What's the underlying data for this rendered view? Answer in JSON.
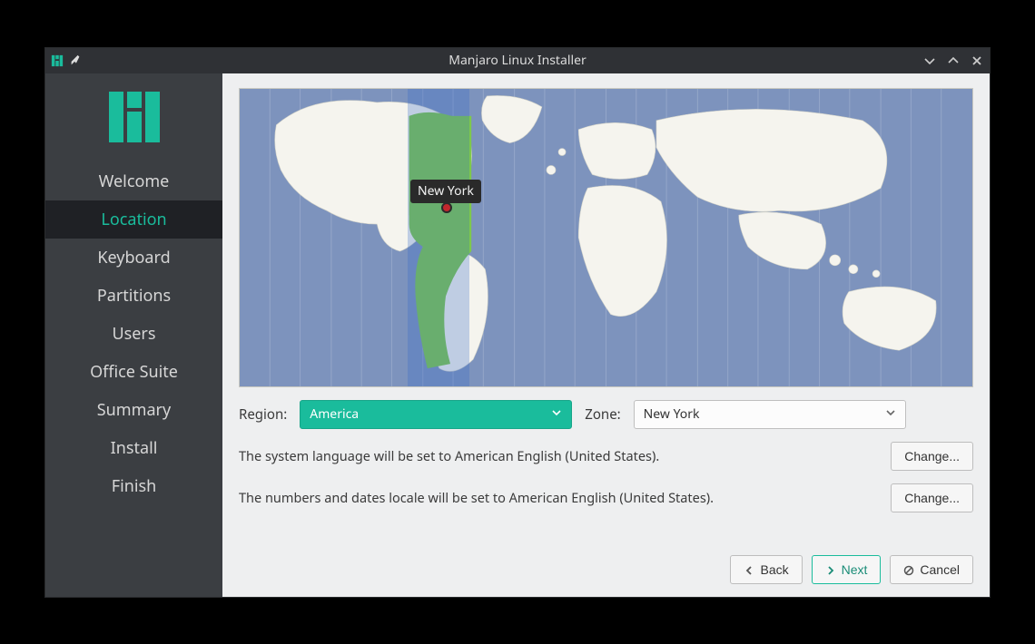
{
  "window": {
    "title": "Manjaro Linux Installer"
  },
  "sidebar": {
    "steps": [
      {
        "label": "Welcome"
      },
      {
        "label": "Location"
      },
      {
        "label": "Keyboard"
      },
      {
        "label": "Partitions"
      },
      {
        "label": "Users"
      },
      {
        "label": "Office Suite"
      },
      {
        "label": "Summary"
      },
      {
        "label": "Install"
      },
      {
        "label": "Finish"
      }
    ],
    "active_index": 1
  },
  "map": {
    "selected_city": "New York"
  },
  "region": {
    "label": "Region:",
    "value": "America"
  },
  "zone": {
    "label": "Zone:",
    "value": "New York"
  },
  "lang_notice": "The system language will be set to American English (United States).",
  "locale_notice": "The numbers and dates locale will be set to American English (United States).",
  "buttons": {
    "change": "Change...",
    "back": "Back",
    "next": "Next",
    "cancel": "Cancel"
  }
}
